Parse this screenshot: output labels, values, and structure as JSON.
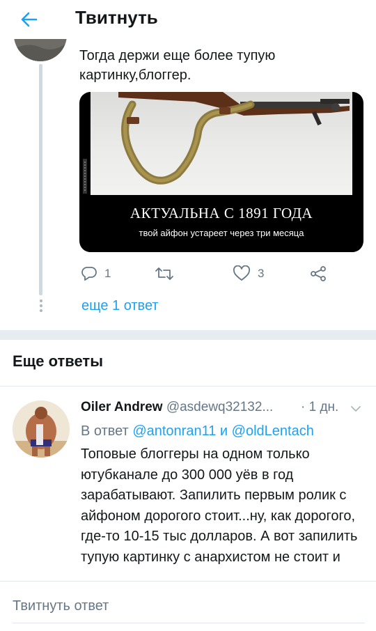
{
  "header": {
    "title": "Твитнуть",
    "back_icon": "arrow-left-icon",
    "accent_color": "#1da1f2"
  },
  "tweet": {
    "text": "Тогда держи еще более тупую картинку,блоггер.",
    "media": {
      "caption_main": "АКТУАЛЬНА С 1891 ГОДА",
      "caption_sub": "твой айфон устареет через три месяца"
    },
    "actions": {
      "reply_icon": "reply-bubble-icon",
      "reply_count": "1",
      "retweet_icon": "retweet-icon",
      "like_icon": "heart-icon",
      "like_count": "3",
      "share_icon": "share-icon"
    },
    "more_replies_label": "еще 1 ответ"
  },
  "more_replies": {
    "section_title": "Еще ответы",
    "reply": {
      "name": "Oiler Andrew",
      "handle": "@asdewq32132...",
      "time": "· 1 дн.",
      "in_reply_prefix": "В ответ ",
      "mention_1": "@antonran11",
      "and_word": " и ",
      "mention_2": "@oldLentach",
      "body": "Топовые блоггеры на одном только ютубканале до 300 000 уёв в год зарабатывают. Запилить первым ролик с айфоном дорогого стоит...ну, как дорогого, где-то 10-15 тыс долларов. А вот запилить тупую картинку с анархистом не стоит и"
    }
  },
  "composer": {
    "placeholder": "Твитнуть ответ"
  }
}
